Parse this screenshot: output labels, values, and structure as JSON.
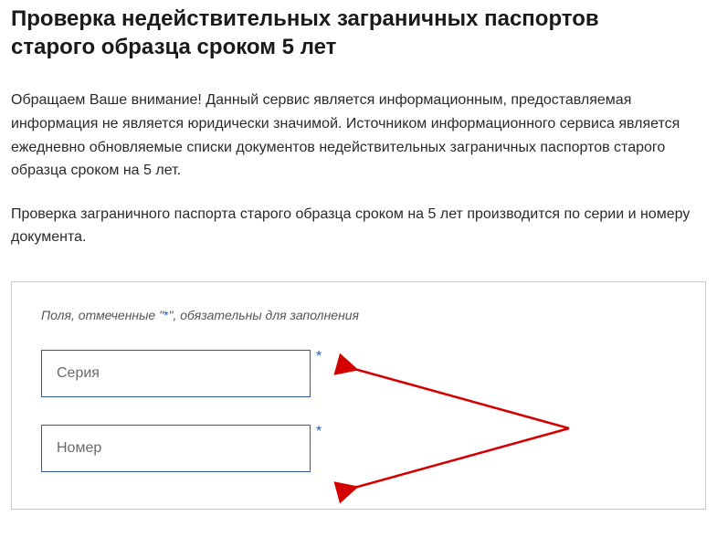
{
  "title": "Проверка недействительных заграничных паспортов старого образца сроком 5 лет",
  "para1": "Обращаем Ваше внимание! Данный сервис является информационным, предоставляемая информация не является юридически значимой. Источником информационного сервиса является ежедневно обновляемые списки документов недействительных заграничных паспортов старого образца сроком на 5 лет.",
  "para2": "Проверка заграничного паспорта старого образца сроком на 5 лет производится по серии и номеру документа.",
  "form": {
    "required_prefix": "Поля, отмеченные \"",
    "required_mark": "*",
    "required_suffix": "\", обязательны для заполнения",
    "series_placeholder": "Серия",
    "number_placeholder": "Номер",
    "asterisk": "*"
  }
}
